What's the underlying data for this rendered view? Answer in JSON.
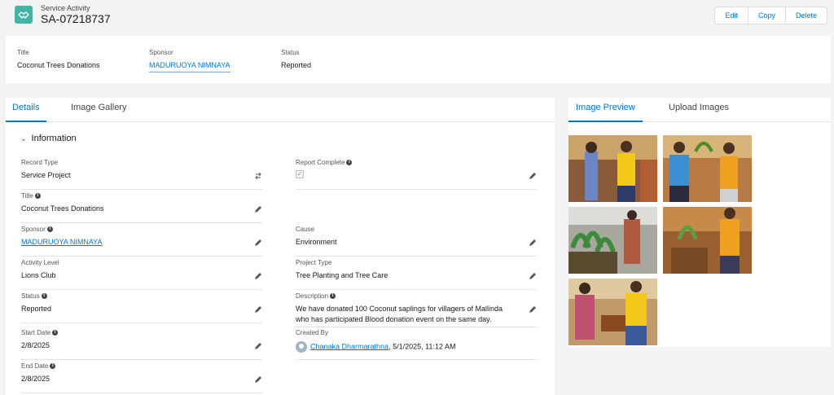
{
  "header": {
    "object_type": "Service Activity",
    "record_number": "SA-07218737",
    "actions": [
      "Edit",
      "Copy",
      "Delete"
    ]
  },
  "highlights": {
    "title_label": "Title",
    "title_value": "Coconut Trees Donations",
    "sponsor_label": "Sponsor",
    "sponsor_value": "MADURUOYA NIMNAYA",
    "status_label": "Status",
    "status_value": "Reported"
  },
  "left_tabs": [
    "Details",
    "Image Gallery"
  ],
  "section_title": "Information",
  "fields": {
    "record_type": {
      "label": "Record Type",
      "value": "Service Project"
    },
    "report_complete": {
      "label": "Report Complete",
      "checked": true
    },
    "title": {
      "label": "Title",
      "value": "Coconut Trees Donations"
    },
    "sponsor": {
      "label": "Sponsor",
      "value": "MADURUOYA NIMNAYA"
    },
    "cause": {
      "label": "Cause",
      "value": "Environment"
    },
    "activity_level": {
      "label": "Activity Level",
      "value": "Lions Club"
    },
    "project_type": {
      "label": "Project Type",
      "value": "Tree Planting and Tree Care"
    },
    "status": {
      "label": "Status",
      "value": "Reported"
    },
    "description": {
      "label": "Description",
      "line1": "We have donated 100 Coconut saplings for villagers of Mallinda",
      "line2": "who has participated Blood donation event on the same day."
    },
    "start_date": {
      "label": "Start Date",
      "value": "2/8/2025"
    },
    "created_by": {
      "label": "Created By",
      "user": "Chanaka Dharmarathna",
      "datetime": ", 5/1/2025, 11:12 AM"
    },
    "end_date": {
      "label": "End Date",
      "value": "2/8/2025"
    }
  },
  "right_tabs": [
    "Image Preview",
    "Upload Images"
  ],
  "colors": {
    "accent": "#0176d3",
    "icon_bg": "#3fb6a3",
    "page_bg": "#f3f3f3"
  }
}
